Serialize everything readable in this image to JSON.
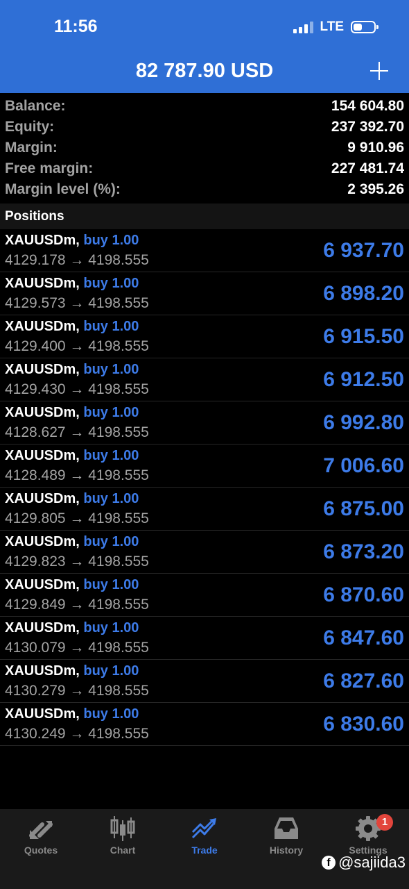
{
  "status_bar": {
    "time": "11:56",
    "network": "LTE"
  },
  "header": {
    "title": "82 787.90 USD"
  },
  "summary": [
    {
      "label": "Balance:",
      "value": "154 604.80"
    },
    {
      "label": "Equity:",
      "value": "237 392.70"
    },
    {
      "label": "Margin:",
      "value": "9 910.96"
    },
    {
      "label": "Free margin:",
      "value": "227 481.74"
    },
    {
      "label": "Margin level (%):",
      "value": "2 395.26"
    }
  ],
  "positions_header": "Positions",
  "positions": [
    {
      "symbol": "XAUUSDm,",
      "side": "buy 1.00",
      "prices": "4129.178 → 4198.555",
      "profit": "6 937.70"
    },
    {
      "symbol": "XAUUSDm,",
      "side": "buy 1.00",
      "prices": "4129.573 → 4198.555",
      "profit": "6 898.20"
    },
    {
      "symbol": "XAUUSDm,",
      "side": "buy 1.00",
      "prices": "4129.400 → 4198.555",
      "profit": "6 915.50"
    },
    {
      "symbol": "XAUUSDm,",
      "side": "buy 1.00",
      "prices": "4129.430 → 4198.555",
      "profit": "6 912.50"
    },
    {
      "symbol": "XAUUSDm,",
      "side": "buy 1.00",
      "prices": "4128.627 → 4198.555",
      "profit": "6 992.80"
    },
    {
      "symbol": "XAUUSDm,",
      "side": "buy 1.00",
      "prices": "4128.489 → 4198.555",
      "profit": "7 006.60"
    },
    {
      "symbol": "XAUUSDm,",
      "side": "buy 1.00",
      "prices": "4129.805 → 4198.555",
      "profit": "6 875.00"
    },
    {
      "symbol": "XAUUSDm,",
      "side": "buy 1.00",
      "prices": "4129.823 → 4198.555",
      "profit": "6 873.20"
    },
    {
      "symbol": "XAUUSDm,",
      "side": "buy 1.00",
      "prices": "4129.849 → 4198.555",
      "profit": "6 870.60"
    },
    {
      "symbol": "XAUUSDm,",
      "side": "buy 1.00",
      "prices": "4130.079 → 4198.555",
      "profit": "6 847.60"
    },
    {
      "symbol": "XAUUSDm,",
      "side": "buy 1.00",
      "prices": "4130.279 → 4198.555",
      "profit": "6 827.60"
    },
    {
      "symbol": "XAUUSDm,",
      "side": "buy 1.00",
      "prices": "4130.249 → 4198.555",
      "profit": "6 830.60"
    }
  ],
  "tabs": [
    {
      "label": "Quotes",
      "icon": "quotes-icon"
    },
    {
      "label": "Chart",
      "icon": "chart-icon"
    },
    {
      "label": "Trade",
      "icon": "trade-icon",
      "active": true
    },
    {
      "label": "History",
      "icon": "history-icon"
    },
    {
      "label": "Settings",
      "icon": "settings-icon",
      "badge": "1"
    }
  ],
  "watermark": "@sajiida3",
  "colors": {
    "header_bg": "#2f6fd6",
    "accent": "#3d7be8",
    "background": "#000000",
    "badge": "#e2453c"
  }
}
